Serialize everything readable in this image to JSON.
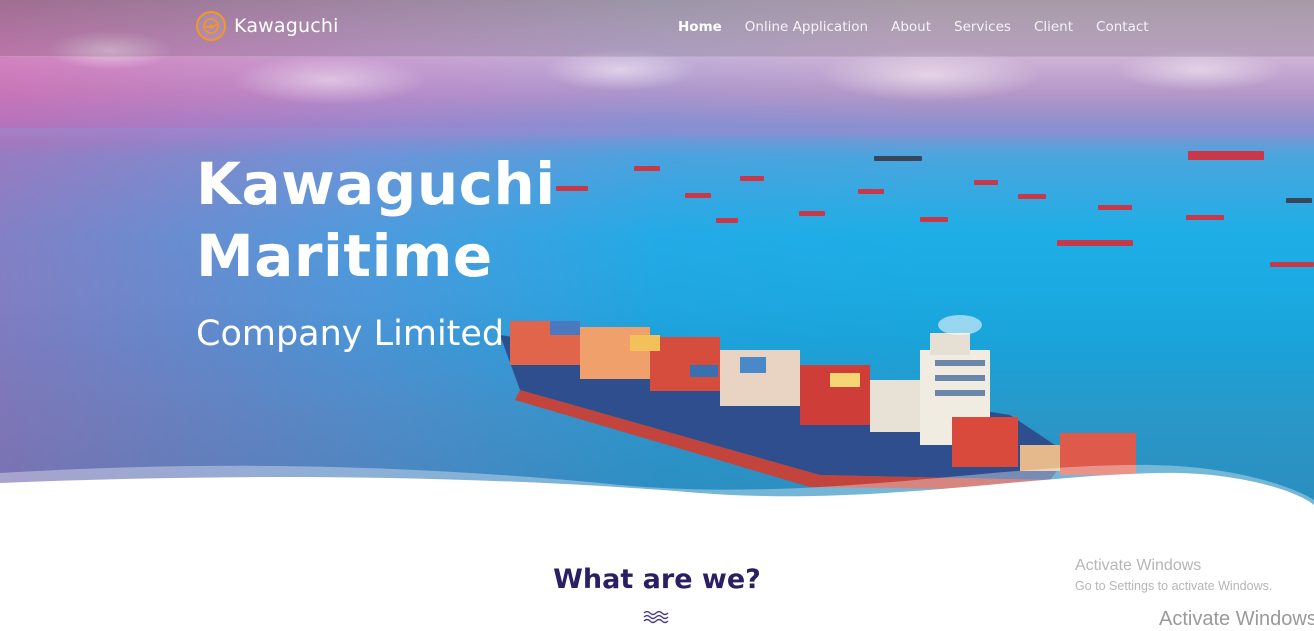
{
  "brand": {
    "name": "Kawaguchi",
    "accent_color": "#f39a1e",
    "logo_icon": "ship-wheel-emblem-icon"
  },
  "nav": {
    "items": [
      {
        "label": "Home",
        "active": true
      },
      {
        "label": "Online Application",
        "active": false
      },
      {
        "label": "About",
        "active": false
      },
      {
        "label": "Services",
        "active": false
      },
      {
        "label": "Client",
        "active": false
      },
      {
        "label": "Contact",
        "active": false
      }
    ]
  },
  "hero": {
    "title_line1": "Kawaguchi",
    "title_line2": "Maritime",
    "subtitle": "Company Limited",
    "image_subject": "container-ship-at-sea"
  },
  "section": {
    "title": "What are we?",
    "title_color": "#2b1e63",
    "divider_icon": "wave-divider-icon"
  },
  "watermark": {
    "title": "Activate Windows",
    "subtitle": "Go to Settings to activate Windows.",
    "title_repeat": "Activate Windows"
  }
}
